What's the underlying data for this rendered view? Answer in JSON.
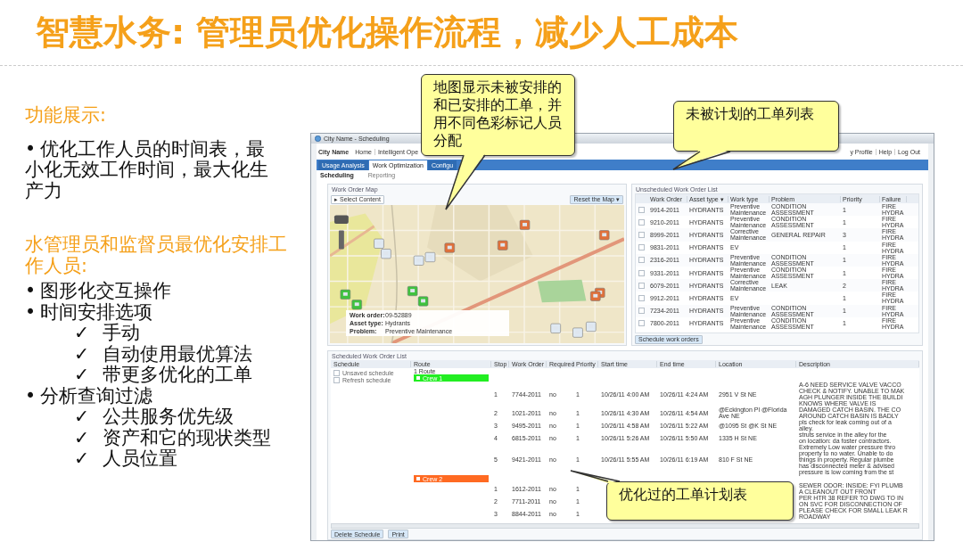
{
  "title": "智慧水务: 管理员优化操作流程，减少人工成本",
  "sections": [
    {
      "heading": "功能展示:",
      "items": [
        {
          "marker": "•",
          "text": "优化工作人员的时间表，最小化无效工作时间，最大化生产力"
        }
      ]
    },
    {
      "heading": "水管理员和监督员最优化安排工作人员:",
      "items": [
        {
          "marker": "•",
          "text": "图形化交互操作"
        },
        {
          "marker": "•",
          "text": "时间安排选项",
          "children": [
            {
              "marker": "✓",
              "text": "手动"
            },
            {
              "marker": "✓",
              "text": "自动使用最优算法"
            },
            {
              "marker": "✓",
              "text": "带更多优化的工单"
            }
          ]
        },
        {
          "marker": "•",
          "text": "分析查询过滤",
          "children": [
            {
              "marker": "✓",
              "text": "公共服务优先级"
            },
            {
              "marker": "✓",
              "text": "资产和它的现状类型"
            },
            {
              "marker": "✓",
              "text": "人员位置"
            }
          ]
        }
      ]
    }
  ],
  "app": {
    "window_title": "City Name - Scheduling",
    "brand": "City Name",
    "nav": [
      "Home",
      "Intelligent Ope"
    ],
    "user_links": [
      "y Profile",
      "Help",
      "Log Out"
    ],
    "tabs": [
      {
        "label": "Usage Analysis",
        "selected": false
      },
      {
        "label": "Work Optimization",
        "selected": true
      },
      {
        "label": "Configu",
        "selected": false
      }
    ],
    "subtabs": [
      {
        "label": "Scheduling",
        "selected": true
      },
      {
        "label": "Reporting",
        "selected": false
      }
    ],
    "map_panel": {
      "title": "Work Order Map",
      "select_button": "Select Content",
      "select_arrow": "▸",
      "reset_button": "Reset the Map",
      "reset_arrow": "▾",
      "popup": [
        {
          "label": "Work order:",
          "value": "09-52889"
        },
        {
          "label": "Asset type:",
          "value": "Hydrants"
        },
        {
          "label": "Problem:",
          "value": "Preventive Maintenance"
        }
      ]
    },
    "unscheduled": {
      "title": "Unscheduled Work Order List",
      "columns": [
        "Work Order",
        "Asset type",
        "Work type",
        "Problem",
        "Priority",
        "Failure"
      ],
      "sort_arrow": "▾",
      "rows": [
        {
          "checked": false,
          "cells": [
            "9914-2011",
            "HYDRANTS",
            "Preventive Maintenance",
            "CONDITION ASSESSMENT",
            "1",
            "FIRE HYDRA"
          ]
        },
        {
          "checked": false,
          "cells": [
            "9210-2011",
            "HYDRANTS",
            "Preventive Maintenance",
            "CONDITION ASSESSMENT",
            "1",
            "FIRE HYDRA"
          ]
        },
        {
          "checked": false,
          "cells": [
            "8999-2011",
            "HYDRANTS",
            "Corrective Maintenance",
            "GENERAL REPAIR",
            "3",
            "FIRE HYDRA"
          ]
        },
        {
          "checked": false,
          "cells": [
            "9831-2011",
            "HYDRANTS",
            "EV",
            "",
            "1",
            "FIRE HYDRA"
          ]
        },
        {
          "checked": false,
          "cells": [
            "2316-2011",
            "HYDRANTS",
            "Preventive Maintenance",
            "CONDITION ASSESSMENT",
            "1",
            "FIRE HYDRA"
          ]
        },
        {
          "checked": false,
          "cells": [
            "9331-2011",
            "HYDRANTS",
            "Preventive Maintenance",
            "CONDITION ASSESSMENT",
            "1",
            "FIRE HYDRA"
          ]
        },
        {
          "checked": false,
          "cells": [
            "6079-2011",
            "HYDRANTS",
            "Corrective Maintenance",
            "LEAK",
            "2",
            "FIRE HYDRA"
          ]
        },
        {
          "checked": false,
          "cells": [
            "9912-2011",
            "HYDRANTS",
            "EV",
            "",
            "1",
            "FIRE HYDRA"
          ]
        },
        {
          "checked": false,
          "cells": [
            "7234-2011",
            "HYDRANTS",
            "Preventive Maintenance",
            "CONDITION ASSESSMENT",
            "1",
            "FIRE HYDRA"
          ]
        },
        {
          "checked": false,
          "cells": [
            "7800-2011",
            "HYDRANTS",
            "Preventive Maintenance",
            "CONDITION ASSESSMENT",
            "1",
            "FIRE HYDRA"
          ]
        }
      ],
      "button": "Schedule work orders"
    },
    "scheduled": {
      "title": "Scheduled Work Order List",
      "columns": [
        "Schedule",
        "Route",
        "Stop",
        "Work Order",
        "Required",
        "Priority",
        "Start time",
        "End time",
        "Location",
        "Description"
      ],
      "schedules": [
        {
          "label": "Unsaved schedule",
          "checked": false
        },
        {
          "label": "Refresh schedule",
          "checked": false
        }
      ],
      "route_count": "1 Route",
      "routes": [
        {
          "name": "Crew 1",
          "color": "#22ee22",
          "stops": [
            {
              "cells": [
                "1",
                "7744-2011",
                "no",
                "1",
                "10/26/11 4:00 AM",
                "10/26/11 4:24 AM",
                "2951 V St NE"
              ],
              "description": [
                "A-6 NEED SERVICE VALVE VACCO",
                "CHECK & NOTIFY. UNABLE TO MAK",
                "AGH PLUNGER INSIDE THE BUILDI",
                "KNOWS WHERE VALVE IS"
              ]
            },
            {
              "cells": [
                "2",
                "1021-2011",
                "no",
                "1",
                "10/26/11 4:30 AM",
                "10/26/11 4:54 AM",
                "@Eckington Pl @Florida Ave NE"
              ],
              "description": [
                "DAMAGED CATCH BASIN. THE CO",
                "AROUND CATCH BASIN IS BADLY"
              ]
            },
            {
              "cells": [
                "3",
                "9495-2011",
                "no",
                "1",
                "10/26/11 4:58 AM",
                "10/26/11 5:22 AM",
                "@1095 St @K St NE"
              ],
              "description": [
                "pls check for leak coming out of a",
                "alley."
              ]
            },
            {
              "cells": [
                "4",
                "6815-2011",
                "no",
                "1",
                "10/26/11 5:26 AM",
                "10/26/11 5:50 AM",
                "1335 H St NE"
              ],
              "description": [
                "struts service in the alley for the",
                "on location: da foster contractors."
              ]
            },
            {
              "cells": [
                "5",
                "9421-2011",
                "no",
                "1",
                "10/26/11 5:55 AM",
                "10/26/11 6:19 AM",
                "810 F St NE"
              ],
              "description": [
                "Extremely Low water pressure thro",
                "property to no water. Unable to do",
                "things in property. Regular plumbe",
                "has disconnected meter & advised",
                "pressure is low coming from the st"
              ]
            }
          ]
        },
        {
          "name": "Crew 2",
          "color": "#ff6a22",
          "stops": [
            {
              "cells": [
                "1",
                "1612-2011",
                "no",
                "1"
              ],
              "description": [
                "SEWER ODOR: INSIDE: FYI PLUMB",
                "A CLEANOUT OUT FRONT"
              ]
            },
            {
              "cells": [
                "2",
                "7711-2011",
                "no",
                "1"
              ],
              "description": [
                "PER HTR 38 REFER TO DWG TO IN",
                "ON SVC FOR DISCONNECTION OF"
              ]
            },
            {
              "cells": [
                "3",
                "8844-2011",
                "no",
                "1"
              ],
              "description": [
                "PLEASE CHECK FOR SMALL LEAK R",
                "ROADWAY"
              ]
            }
          ]
        }
      ],
      "buttons": [
        "Delete Schedule",
        "Print"
      ]
    }
  },
  "callouts": [
    {
      "kind": "map",
      "text": "地图显示未被安排的和已安排的工单，并用不同色彩标记人员分配"
    },
    {
      "kind": "list",
      "text": "未被计划的工单列表"
    },
    {
      "kind": "schedule",
      "text": "优化过的工单计划表"
    }
  ]
}
